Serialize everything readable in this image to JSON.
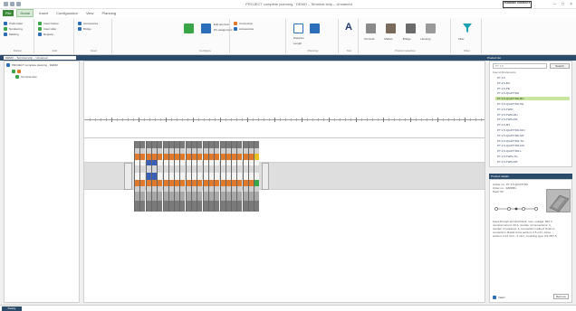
{
  "window": {
    "title": "PROJECT complete planning · DEMO – Terminal strip – Unnamed",
    "brand": "PHOENIX CONTACT",
    "controls": [
      "–",
      "□",
      "×"
    ]
  },
  "menu": {
    "tabs": [
      "File",
      "Home",
      "Insert",
      "Configuration",
      "View",
      "Planning"
    ]
  },
  "ribbon": {
    "groups": [
      {
        "label": "Marker",
        "rows": [
          "Prefix label",
          "Numbering",
          "Marking",
          "Suffix"
        ]
      },
      {
        "label": "Edit",
        "rows": [
          "Insert before",
          "Insert after",
          "Replace",
          "Delete"
        ]
      },
      {
        "label": "Insert",
        "rows": [
          "Accessories",
          "Bridge"
        ]
      },
      {
        "label": "Configure",
        "rows": [
          "Connection",
          "Accessories",
          "Edit terminal",
          "Pin assignment"
        ]
      },
      {
        "label": "Planning",
        "rows": [
          "Distance",
          "Length"
        ]
      },
      {
        "label": "Text",
        "rows": [
          "Text"
        ]
      },
      {
        "label": "Product selection",
        "rows": [
          "Terminal",
          "Marker",
          "Bridge",
          "Housing"
        ]
      },
      {
        "label": "Filter",
        "rows": [
          "Filter"
        ]
      }
    ],
    "green_icon": "#3aa64a",
    "blue_icon": "#2a6fb8",
    "filter_icon_color": "#1aa0b0"
  },
  "strip": {
    "left_selector": "DEMO – Terminal strip – Unnamed",
    "right": "Product list"
  },
  "tree": {
    "root": "PROJECT complete planning · DEMO",
    "child": "Terminal strip"
  },
  "canvas": {
    "band_color": "#dedede",
    "accent_color": "#e07a2a"
  },
  "search": {
    "placeholder": "PT 2,5",
    "button": "Search",
    "results_label": "Found 20 elements",
    "items": [
      "PT 2,5",
      "PT 2,5-BU",
      "PT 2,5-PE",
      "PT 2,5-QUATTRO",
      "PT 2,5-QUATTRO-BU",
      "PT 2,5-QUATTRO-PE",
      "PT 2,5-TWIN",
      "PT 2,5-TWIN-BU",
      "PT 2,5-TWIN-PE",
      "PT 2,5-MT",
      "PT 2,5-QUATTRO-DIO",
      "PT 2,5-QUATTRO-MT",
      "PT 2,5-QUATTRO-TG",
      "PT 2,5-QUATTRO-FSI",
      "PT 2,5-QUATTRO-L",
      "PT 2,5-TWIN-TG",
      "PT 2,5-TWIN-MT"
    ],
    "selected_index": 4
  },
  "details": {
    "header": "Product details",
    "lines": [
      "Article no.: PT 2,5-QUATTRO",
      "Order no.: 3209581",
      "Pack: 50",
      "Feed-through terminal block, nom. voltage: 500 V,",
      "nominal current: 20 A, number of connections: 4,",
      "number of positions: 1, connection method: Push-in",
      "connection, Rated cross section: 2.5 mm², cross",
      "section: 0.14 mm² - 4 mm², mounting type: NS 35/7,5"
    ],
    "footer_left": "Insert",
    "footer_right": "Remove"
  },
  "status": {
    "left": "Ready"
  }
}
